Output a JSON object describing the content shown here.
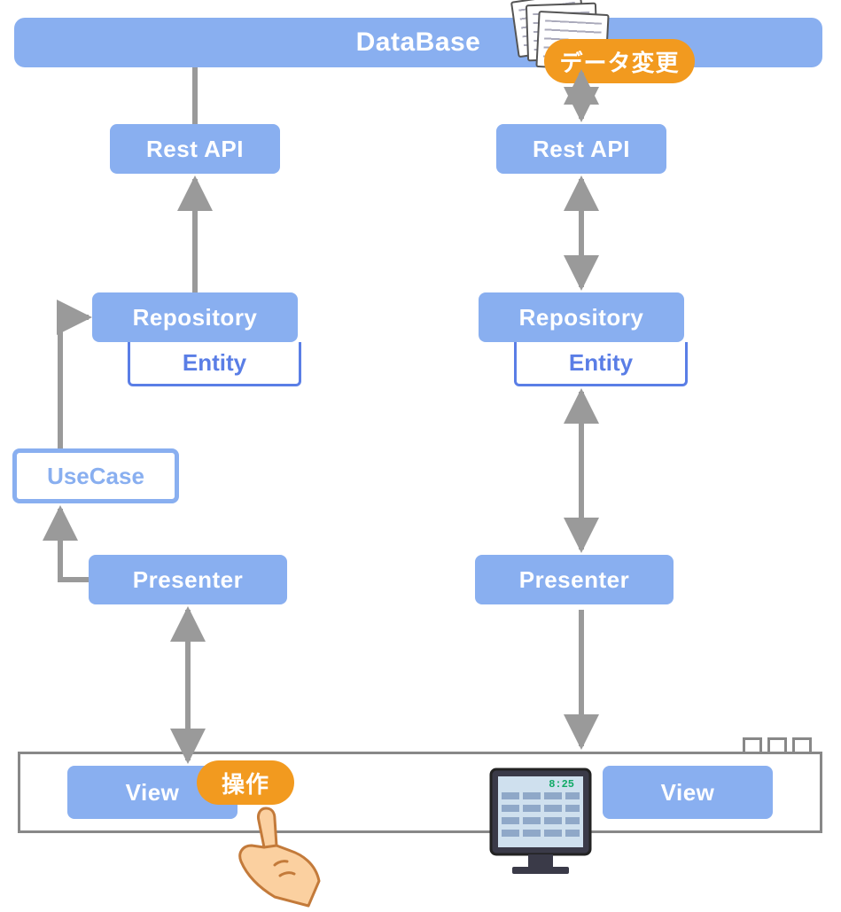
{
  "database": {
    "label": "DataBase"
  },
  "left": {
    "rest_api": "Rest API",
    "repository": "Repository",
    "entity": "Entity",
    "usecase": "UseCase",
    "presenter": "Presenter",
    "view": "View"
  },
  "right": {
    "rest_api": "Rest API",
    "repository": "Repository",
    "entity": "Entity",
    "presenter": "Presenter",
    "view": "View"
  },
  "badges": {
    "data_change": "データ変更",
    "operate": "操作"
  },
  "monitor": {
    "time": "8:25"
  },
  "colors": {
    "box_fill": "#89aff0",
    "entity_border": "#5a7ee6",
    "badge": "#f29a1f",
    "arrow": "#9a9a9a",
    "container": "#888"
  }
}
